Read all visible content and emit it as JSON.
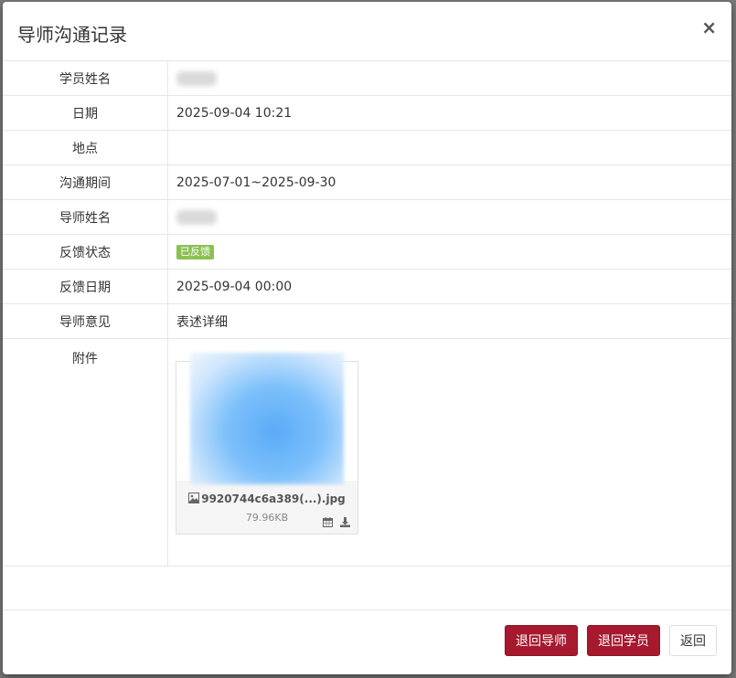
{
  "modal": {
    "title": "导师沟通记录",
    "close_symbol": "×"
  },
  "fields": [
    {
      "label": "学员姓名",
      "value": "",
      "blurred": true
    },
    {
      "label": "日期",
      "value": "2025-09-04 10:21"
    },
    {
      "label": "地点",
      "value": ""
    },
    {
      "label": "沟通期间",
      "value": "2025-07-01~2025-09-30"
    },
    {
      "label": "导师姓名",
      "value": "",
      "blurred": true
    },
    {
      "label": "反馈状态",
      "badge": "已反馈"
    },
    {
      "label": "反馈日期",
      "value": "2025-09-04 00:00"
    },
    {
      "label": "导师意见",
      "value": "表述详细"
    }
  ],
  "attachment": {
    "label": "附件",
    "file_name": "9920744c6a389(...).jpg",
    "file_size": "79.96KB",
    "icons": [
      "image-icon",
      "calendar-icon",
      "download-icon"
    ]
  },
  "footer": {
    "return_mentor": "退回导师",
    "return_student": "退回学员",
    "back": "返回"
  },
  "colors": {
    "primary": "#a6192e",
    "badge": "#8cc152",
    "backdrop": "#7a7a7a"
  }
}
